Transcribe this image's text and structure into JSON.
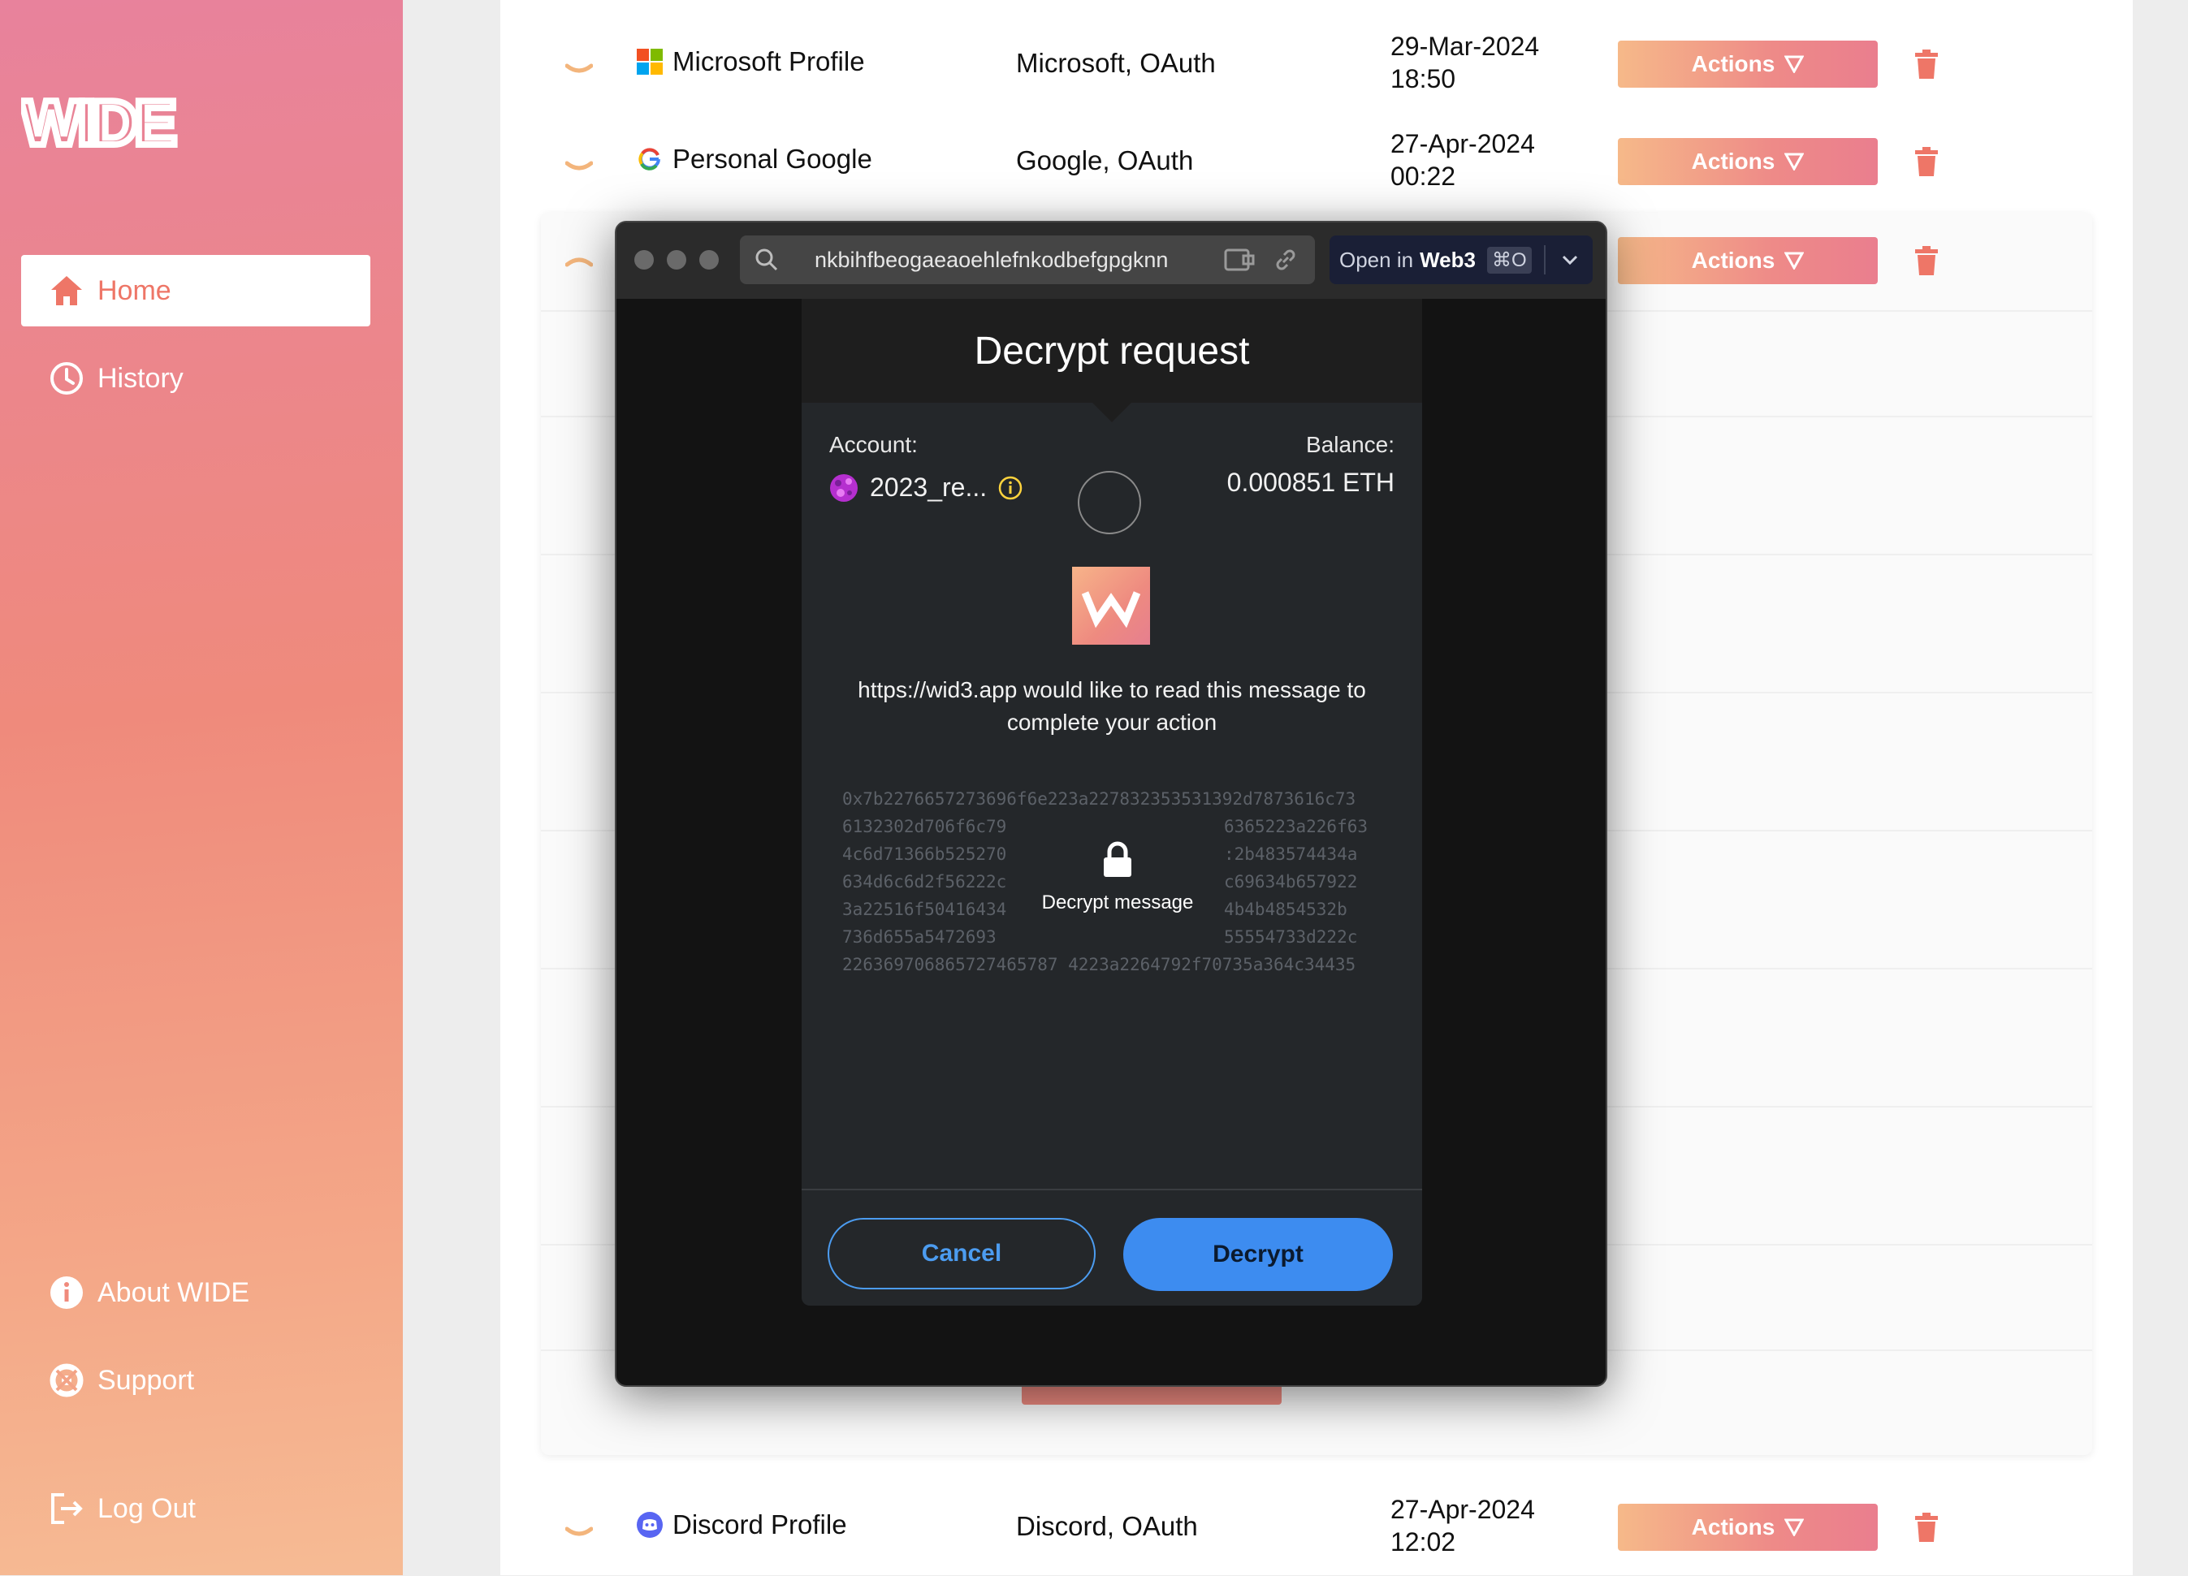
{
  "brand": {
    "logo_text": "WIDE"
  },
  "sidebar": {
    "nav": [
      {
        "label": "Home",
        "icon": "home-icon",
        "active": true
      },
      {
        "label": "History",
        "icon": "clock-icon",
        "active": false
      }
    ],
    "bottom": [
      {
        "label": "About WIDE",
        "icon": "info-icon"
      },
      {
        "label": "Support",
        "icon": "lifebuoy-icon"
      },
      {
        "label": "Log Out",
        "icon": "logout-icon"
      }
    ]
  },
  "rows": [
    {
      "service": "Microsoft Profile",
      "type": "Microsoft, OAuth",
      "date": "29-Mar-2024",
      "time": "18:50",
      "actions": "Actions"
    },
    {
      "service": "Personal Google",
      "type": "Google, OAuth",
      "date": "27-Apr-2024",
      "time": "00:22",
      "actions": "Actions"
    },
    {
      "actions": "Actions"
    },
    {
      "service": "Discord Profile",
      "type": "Discord, OAuth",
      "date": "27-Apr-2024",
      "time": "12:02",
      "actions": "Actions"
    }
  ],
  "popup": {
    "url": "nkbihfbeogaeaoehlefnkodbefgpgknn",
    "open_in": {
      "prefix": "Open in",
      "app": "Web3",
      "shortcut": "⌘O"
    },
    "title": "Decrypt request",
    "account_label": "Account:",
    "account_name": "2023_re...",
    "balance_label": "Balance:",
    "balance_value": "0.000851 ETH",
    "message_line1": "https://wid3.app would like to read this message to",
    "message_line2": "complete your action",
    "hex_lines": [
      "0x7b2276657273696f6e223a227832353531392d7873616c73",
      "6132302d706f6c79",
      "4c6d71366b525270",
      "634d6c6d2f56222c",
      "3a22516f50416434",
      "736d655a5472693",
      "226369706865727465787 4223a2264792f70735a364c34435"
    ],
    "hex_right": [
      "6365223a226f63",
      ":2b483574434a",
      "c69634b657922",
      "4b4b4854532b",
      "55554733d222c"
    ],
    "decrypt_message": "Decrypt message",
    "cancel": "Cancel",
    "decrypt": "Decrypt"
  },
  "colors": {
    "accent": "#ee7667",
    "metamask_blue": "#3d8cf0"
  }
}
